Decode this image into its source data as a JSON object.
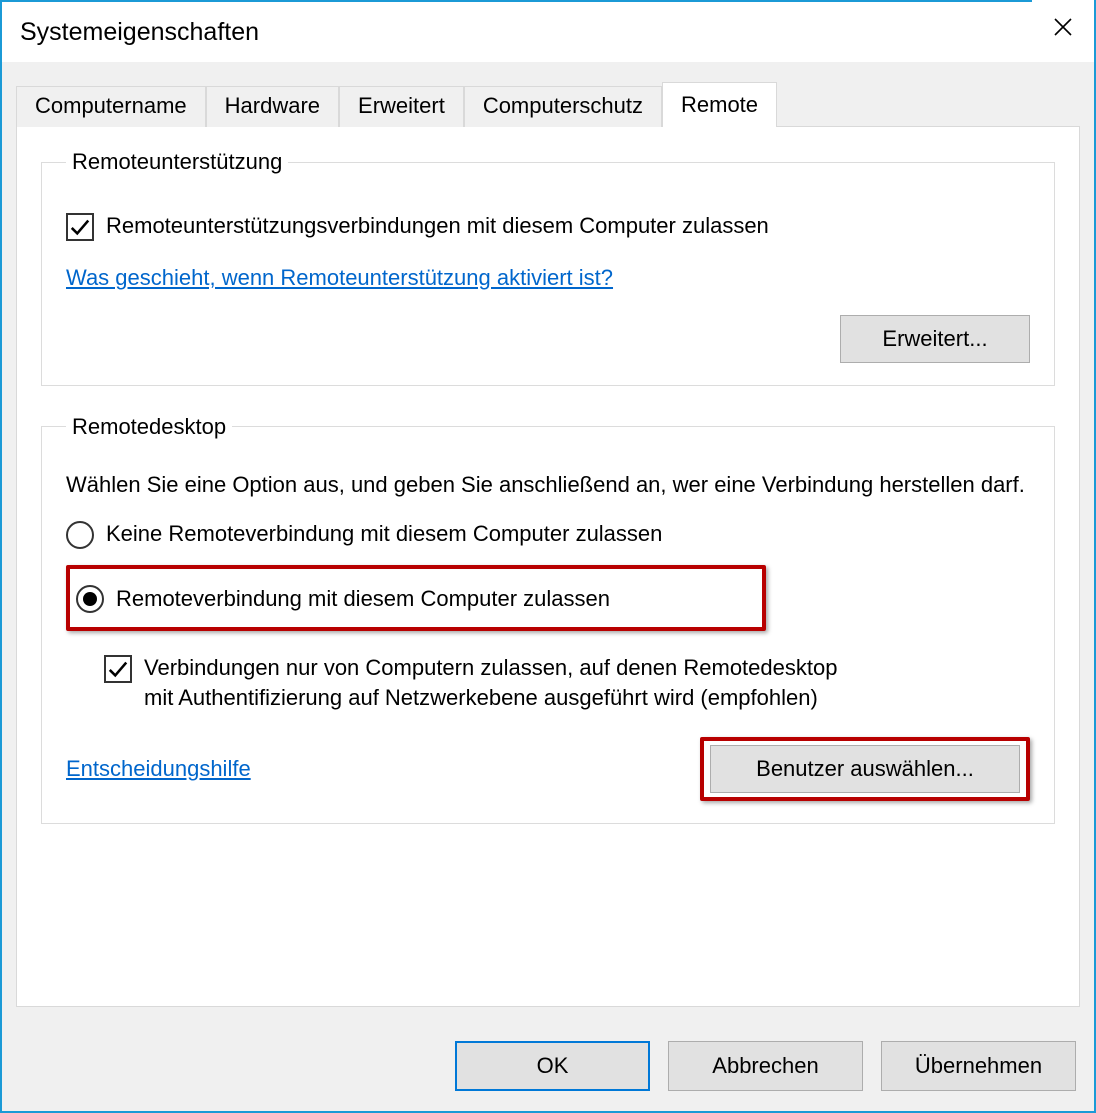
{
  "window": {
    "title": "Systemeigenschaften"
  },
  "tabs": {
    "0": "Computername",
    "1": "Hardware",
    "2": "Erweitert",
    "3": "Computerschutz",
    "4": "Remote"
  },
  "group1": {
    "legend": "Remoteunterstützung",
    "checkbox_label": "Remoteunterstützungsverbindungen mit diesem Computer zulassen",
    "help_link": "Was geschieht, wenn Remoteunterstützung aktiviert ist?",
    "advanced_button": "Erweitert..."
  },
  "group2": {
    "legend": "Remotedesktop",
    "intro": "Wählen Sie eine Option aus, und geben Sie anschließend an, wer eine Verbindung herstellen darf.",
    "radio_deny": "Keine Remoteverbindung mit diesem Computer zulassen",
    "radio_allow": "Remoteverbindung mit diesem Computer zulassen",
    "nla_checkbox": "Verbindungen nur von Computern zulassen, auf denen Remotedesktop mit Authentifizierung auf Netzwerkebene ausgeführt wird (empfohlen)",
    "help_link": "Entscheidungshilfe",
    "select_users_button": "Benutzer auswählen..."
  },
  "buttons": {
    "ok": "OK",
    "cancel": "Abbrechen",
    "apply": "Übernehmen"
  }
}
